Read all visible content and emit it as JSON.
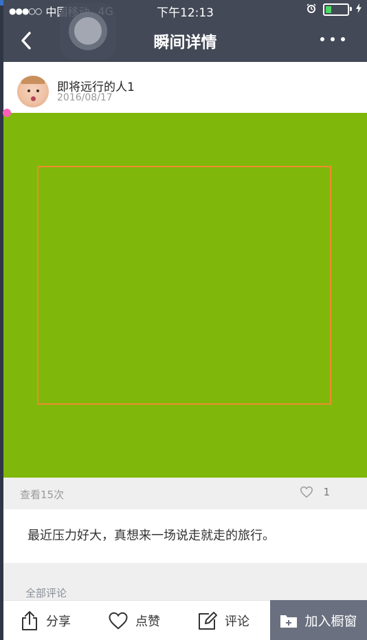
{
  "status_bar": {
    "signal": "●●●○○",
    "carrier": "中国移动",
    "network": "4G",
    "time": "下午12:13",
    "alarm_icon": "alarm-clock-icon",
    "battery_icon": "battery-icon",
    "charging_icon": "lightning-icon",
    "battery_level": 0.3,
    "battery_color": "#4cd964"
  },
  "nav": {
    "title": "瞬间详情",
    "back_icon": "chevron-left-icon",
    "more_icon": "more-dots-icon",
    "background_color": "#434956"
  },
  "post": {
    "author_name": "即将远行的人1",
    "date": "2016/08/17",
    "media_color": "#7fb80a",
    "frame_color": "#f08a2e",
    "view_count": "查看15次",
    "like_count": "1",
    "description": "最近压力好大，真想来一场说走就走的旅行。"
  },
  "comments": {
    "header": "全部评论"
  },
  "toolbar": {
    "share_label": "分享",
    "like_label": "点赞",
    "comment_label": "评论",
    "window_label": "加入橱窗",
    "window_color": "#6a707f"
  }
}
